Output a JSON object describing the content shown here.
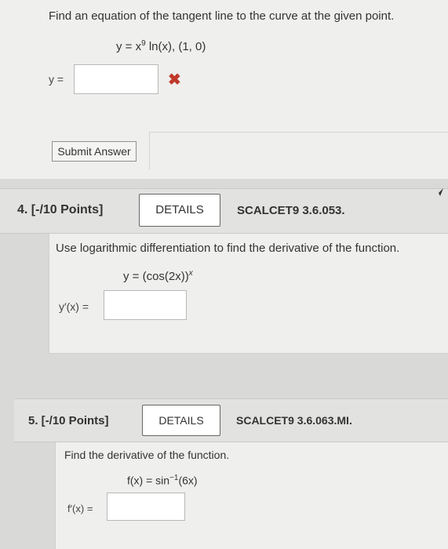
{
  "problem3": {
    "prompt": "Find an equation of the tangent line to the curve at the given point.",
    "equation_lhs": "y = x",
    "equation_exp": "9",
    "equation_rhs": " ln(x),    (1, 0)",
    "answer_label": "y =",
    "answer_value": "",
    "incorrect_mark": "✖",
    "submit_label": "Submit Answer"
  },
  "problem4": {
    "number": "4.  [-/10 Points]",
    "details_label": "DETAILS",
    "code": "SCALCET9 3.6.053.",
    "prompt": "Use logarithmic differentiation to find the derivative of the function.",
    "equation_base": "y = (cos(2x))",
    "equation_exp": "x",
    "answer_label": "y′(x) =",
    "answer_value": ""
  },
  "problem5": {
    "number": "5.  [-/10 Points]",
    "details_label": "DETAILS",
    "code": "SCALCET9 3.6.063.MI.",
    "prompt": "Find the derivative of the function.",
    "equation_lhs": "f(x)  =  sin",
    "equation_exp": "−1",
    "equation_rhs": "(6x)",
    "answer_label": "f′(x) =",
    "answer_value": ""
  },
  "colors": {
    "incorrect": "#c0392b",
    "background": "#d9d9d7",
    "card": "#efefed",
    "header": "#e2e2e0"
  }
}
